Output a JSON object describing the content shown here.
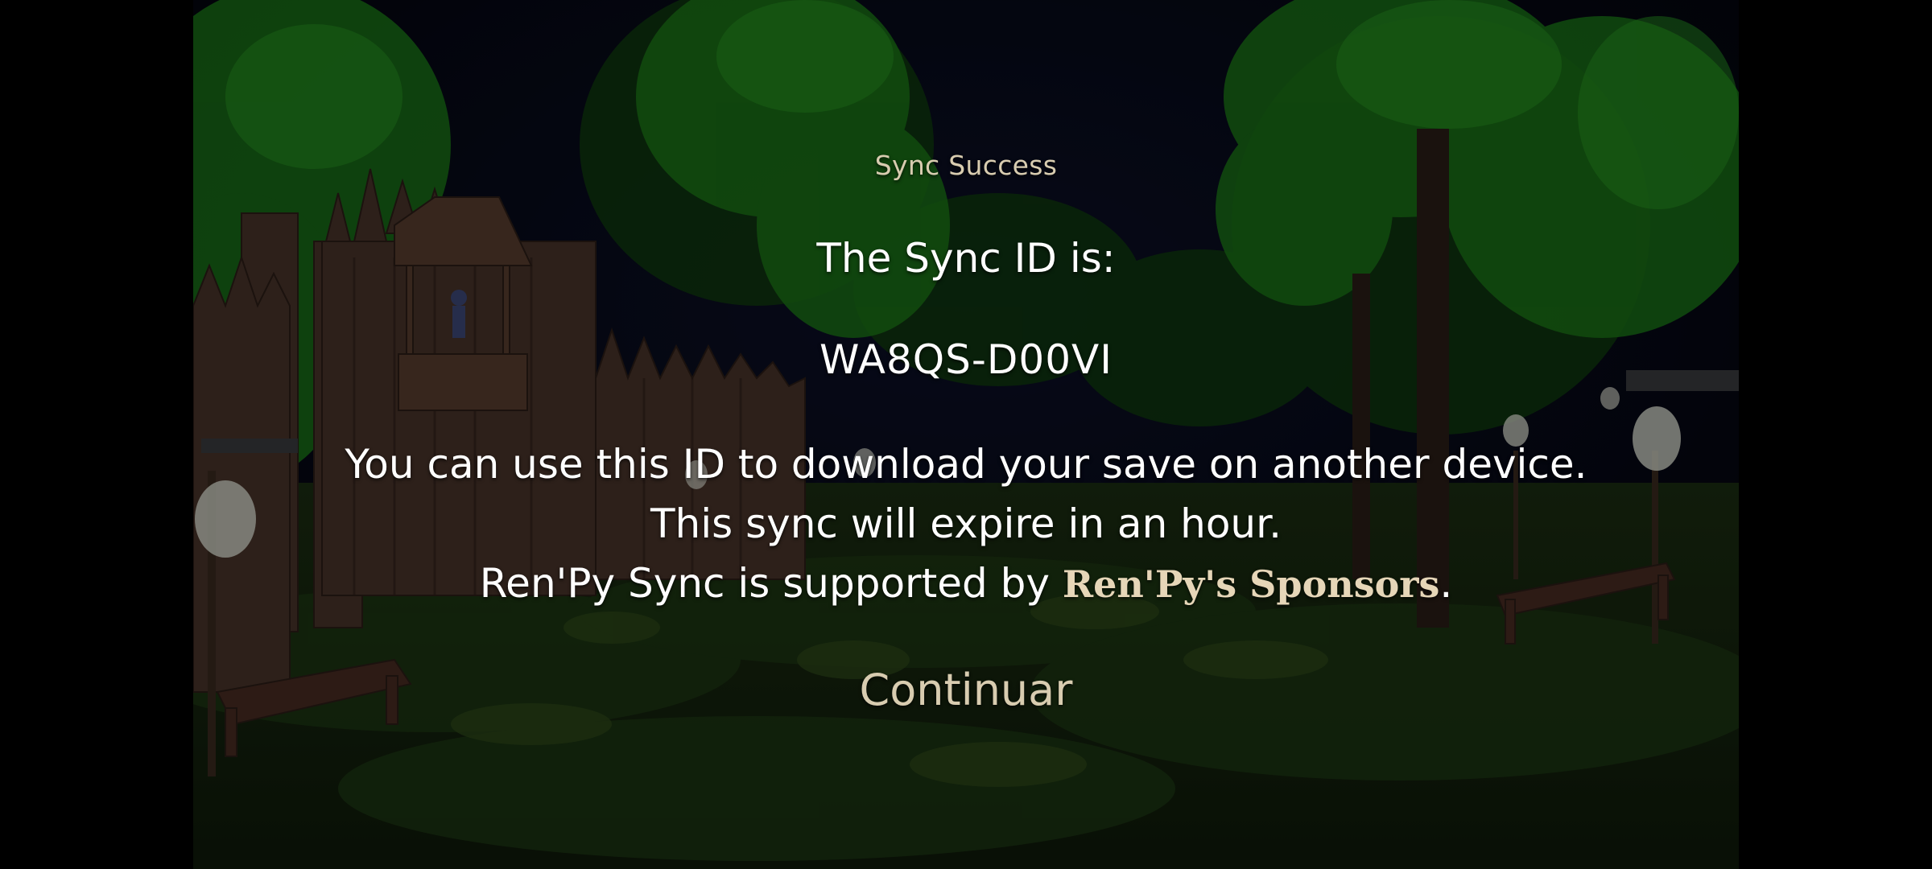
{
  "dialog": {
    "title": "Sync Success",
    "id_label": "The Sync ID is:",
    "sync_id": "WA8QS-D00VI",
    "line1": "You can use this ID to download your save on another device.",
    "line2": "This sync will expire in an hour.",
    "line3_prefix": "Ren'Py Sync is supported by ",
    "sponsors_link": "Ren'Py's Sponsors",
    "line3_suffix": ".",
    "continue_label": "Continuar"
  },
  "colors": {
    "accent_text": "#d8ccb0",
    "link_text": "#e6d6b8",
    "body_text": "#ffffff",
    "letterbox": "#000000"
  }
}
